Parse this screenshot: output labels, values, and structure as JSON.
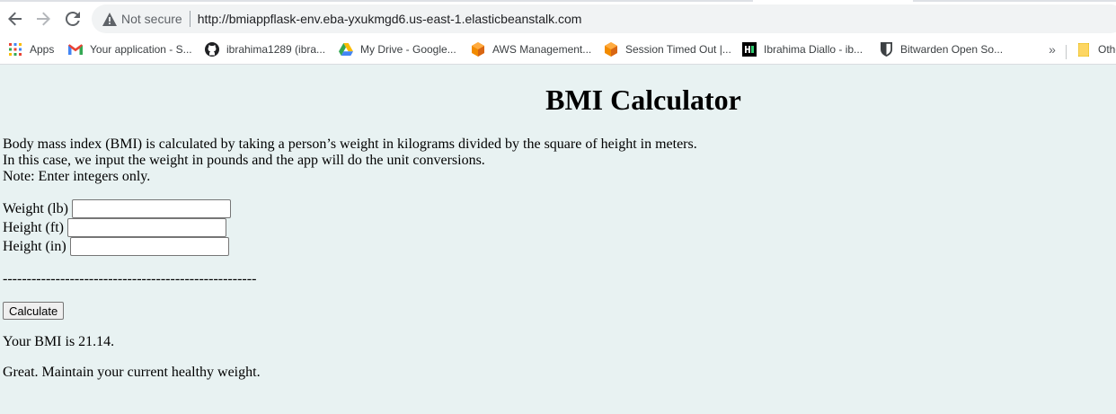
{
  "browser": {
    "security_label": "Not secure",
    "url": "http://bmiappflask-env.eba-yxukmgd6.us-east-1.elasticbeanstalk.com",
    "icons": {
      "back": "back-arrow-icon",
      "forward": "forward-arrow-icon",
      "reload": "reload-icon",
      "security": "warning-triangle-icon"
    },
    "bookmarks": [
      {
        "label": "Apps",
        "icon": "apps-grid-icon",
        "color": "#4285f4"
      },
      {
        "label": "Your application - S...",
        "icon": "gmail-icon",
        "color": "#ea4335"
      },
      {
        "label": "ibrahima1289 (ibra...",
        "icon": "github-icon",
        "color": "#202124"
      },
      {
        "label": "My Drive - Google...",
        "icon": "google-drive-icon",
        "color": "#34a853"
      },
      {
        "label": "AWS Management...",
        "icon": "aws-box-icon",
        "color": "#f28b00"
      },
      {
        "label": "Session Timed Out |...",
        "icon": "aws-box-icon",
        "color": "#f28b00"
      },
      {
        "label": "Ibrahima Diallo - ib...",
        "icon": "hashnode-icon",
        "color": "#000000"
      },
      {
        "label": "Bitwarden Open So...",
        "icon": "bitwarden-shield-icon",
        "color": "#3c4043"
      }
    ],
    "overflow_label": "»",
    "other_bookmarks": {
      "label": "Othe",
      "icon": "folder-icon",
      "color": "#fdd663"
    }
  },
  "page": {
    "title": "BMI Calculator",
    "intro_lines": [
      "Body mass index (BMI) is calculated by taking a person’s weight in kilograms divided by the square of height in meters.",
      "In this case, we input the weight in pounds and the app will do the unit conversions.",
      "Note: Enter integers only."
    ],
    "form": {
      "weight_label": "Weight (lb)",
      "weight_value": "",
      "height_ft_label": "Height (ft)",
      "height_ft_value": "",
      "height_in_label": "Height (in)",
      "height_in_value": ""
    },
    "separator": "-----------------------------------------------------",
    "calculate_label": "Calculate",
    "result": "Your BMI is 21.14.",
    "advice": "Great. Maintain your current healthy weight."
  },
  "colors": {
    "page_background": "#e8f2f2",
    "toolbar_background": "#ffffff",
    "omnibox_background": "#f1f3f4"
  }
}
